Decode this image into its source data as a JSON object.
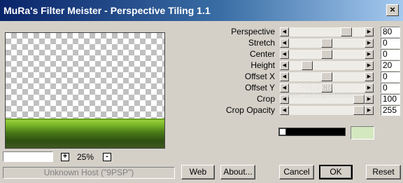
{
  "window": {
    "title": "MuRa's Filter Meister - Perspective Tiling 1.1",
    "close": "×"
  },
  "zoom": {
    "minus": "-",
    "plus": "+",
    "value": "25%"
  },
  "status": "Unknown Host (\"9PSP\")",
  "controls": [
    {
      "label": "Perspective",
      "value": "80",
      "fraction": 0.8
    },
    {
      "label": "Stretch",
      "value": "0",
      "fraction": 0.5
    },
    {
      "label": "Center",
      "value": "0",
      "fraction": 0.5
    },
    {
      "label": "Height",
      "value": "20",
      "fraction": 0.2
    },
    {
      "label": "Offset X",
      "value": "0",
      "fraction": 0.5
    },
    {
      "label": "Offset Y",
      "value": "0",
      "fraction": 0.5
    },
    {
      "label": "Crop",
      "value": "100",
      "fraction": 1.0
    },
    {
      "label": "Crop Opacity",
      "value": "255",
      "fraction": 1.0
    }
  ],
  "watermark": {
    "line1": "Pinuccia",
    "line2": "www.paidiregrafica.eu"
  },
  "color": {
    "swatch": "#d4e8c0"
  },
  "buttons": {
    "web": "Web",
    "about": "About...",
    "cancel": "Cancel",
    "ok": "OK",
    "reset": "Reset"
  },
  "arrows": {
    "left": "◀",
    "right": "▶"
  }
}
